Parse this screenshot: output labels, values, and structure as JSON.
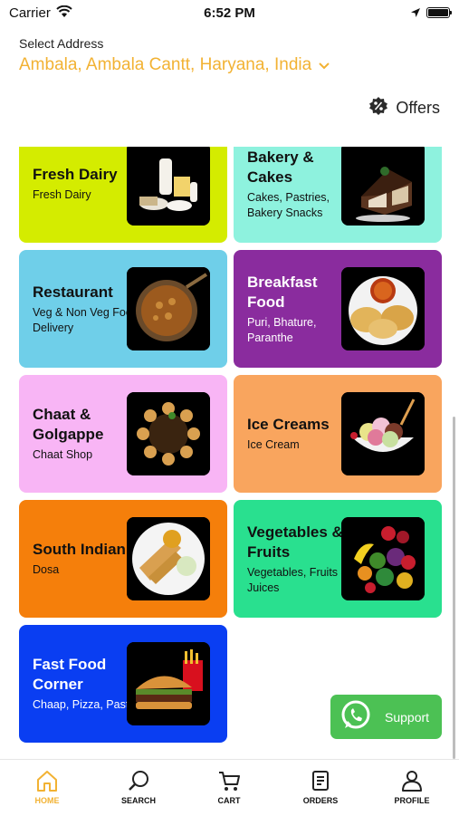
{
  "status_bar": {
    "carrier": "Carrier",
    "time": "6:52 PM"
  },
  "header": {
    "select_label": "Select Address",
    "address": "Ambala, Ambala Cantt, Haryana, India",
    "offers_label": "Offers"
  },
  "categories": [
    {
      "title": "Fresh Dairy",
      "subtitle": "Fresh Dairy",
      "color": "#d4ec00",
      "text": "dark"
    },
    {
      "title": "Bakery & Cakes",
      "subtitle": "Cakes, Pastries, Bakery Snacks",
      "color": "#8ef2de",
      "text": "dark"
    },
    {
      "title": "Restaurant",
      "subtitle": "Veg & Non Veg Food Delivery",
      "color": "#6fcfe9",
      "text": "dark"
    },
    {
      "title": "Breakfast Food",
      "subtitle": "Puri, Bhature, Paranthe",
      "color": "#8a2c9e",
      "text": "light"
    },
    {
      "title": "Chaat & Golgappe",
      "subtitle": "Chaat Shop",
      "color": "#f8b5f5",
      "text": "dark"
    },
    {
      "title": "Ice Creams",
      "subtitle": "Ice Cream",
      "color": "#f9a55e",
      "text": "dark"
    },
    {
      "title": "South Indian",
      "subtitle": "Dosa",
      "color": "#f57f0b",
      "text": "dark"
    },
    {
      "title": "Vegetables & Fruits",
      "subtitle": "Vegetables, Fruits & Juices",
      "color": "#29e08f",
      "text": "dark"
    },
    {
      "title": "Fast Food Corner",
      "subtitle": "Chaap, Pizza, Pasta",
      "color": "#0a3ef2",
      "text": "light"
    }
  ],
  "support": {
    "label": "Support",
    "color": "#4cc154"
  },
  "tabbar": {
    "items": [
      {
        "label": "HOME",
        "icon": "home-icon",
        "active": true
      },
      {
        "label": "SEARCH",
        "icon": "search-icon"
      },
      {
        "label": "CART",
        "icon": "cart-icon"
      },
      {
        "label": "ORDERS",
        "icon": "orders-icon"
      },
      {
        "label": "PROFILE",
        "icon": "profile-icon"
      }
    ],
    "active_color": "#f2b233"
  }
}
